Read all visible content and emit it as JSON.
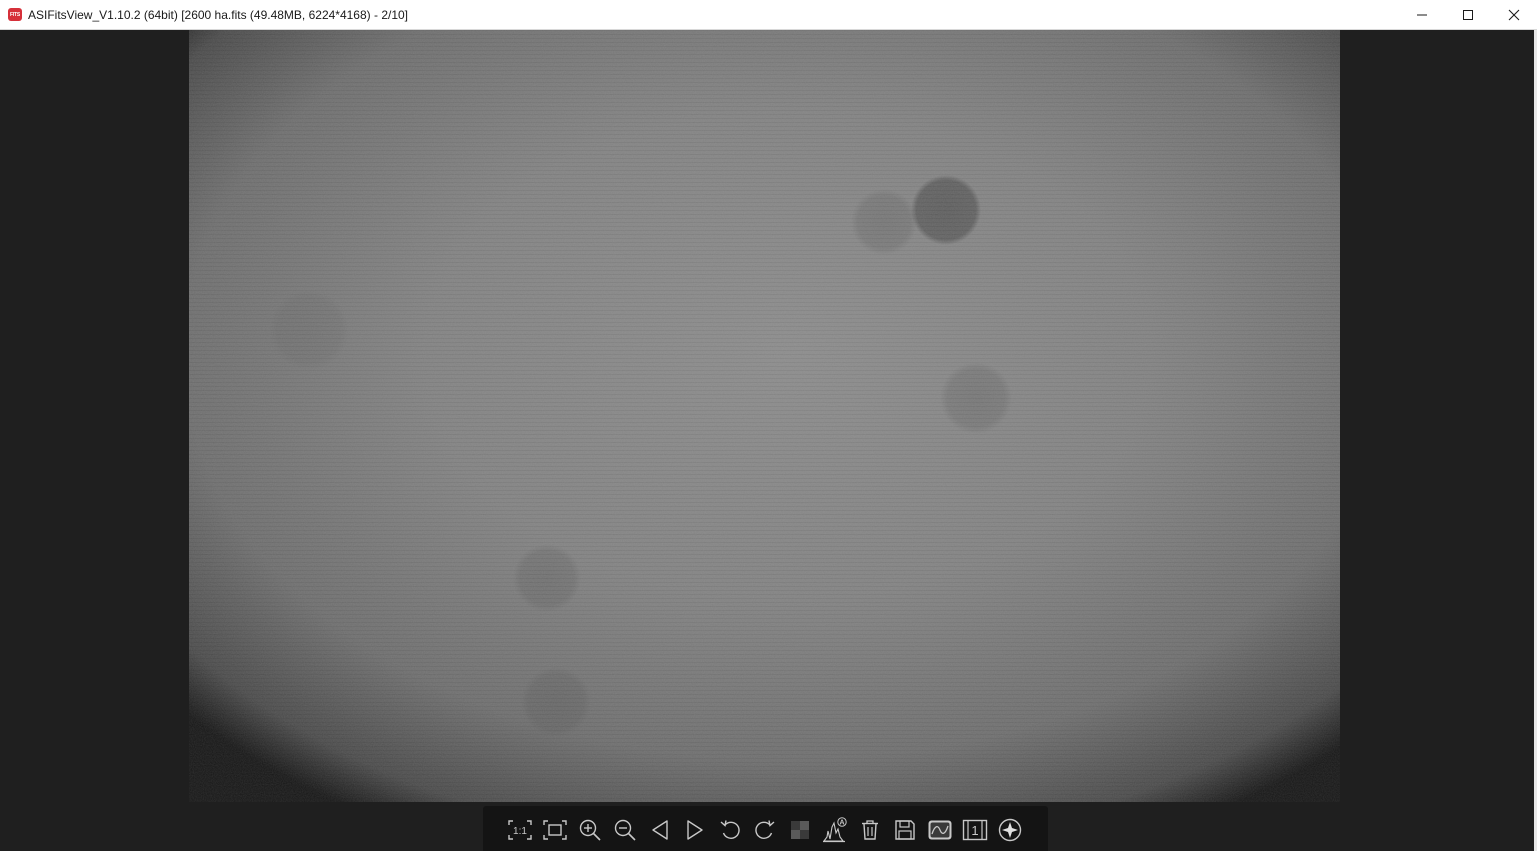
{
  "window": {
    "title": "ASIFitsView_V1.10.2 (64bit) [2600 ha.fits (49.48MB, 6224*4168) - 2/10]",
    "app_icon_text": "FITS",
    "controls": [
      "minimize-icon",
      "maximize-icon",
      "close-icon"
    ]
  },
  "toolbar": {
    "items": [
      {
        "name": "actual-size-icon",
        "label": "1:1"
      },
      {
        "name": "fit-window-icon"
      },
      {
        "name": "zoom-in-icon"
      },
      {
        "name": "zoom-out-icon"
      },
      {
        "name": "previous-icon"
      },
      {
        "name": "next-icon"
      },
      {
        "name": "rotate-left-icon"
      },
      {
        "name": "rotate-right-icon"
      },
      {
        "name": "debayer-icon"
      },
      {
        "name": "histogram-icon",
        "label": "A"
      },
      {
        "name": "delete-icon"
      },
      {
        "name": "save-icon"
      },
      {
        "name": "stretch-icon"
      },
      {
        "name": "header-info-icon",
        "label": "1"
      },
      {
        "name": "star-icon"
      }
    ]
  },
  "colors": {
    "background": "#1f1f1f",
    "toolbar": "#141414",
    "icon": "#c8c8c8",
    "app_icon": "#d6303a"
  }
}
